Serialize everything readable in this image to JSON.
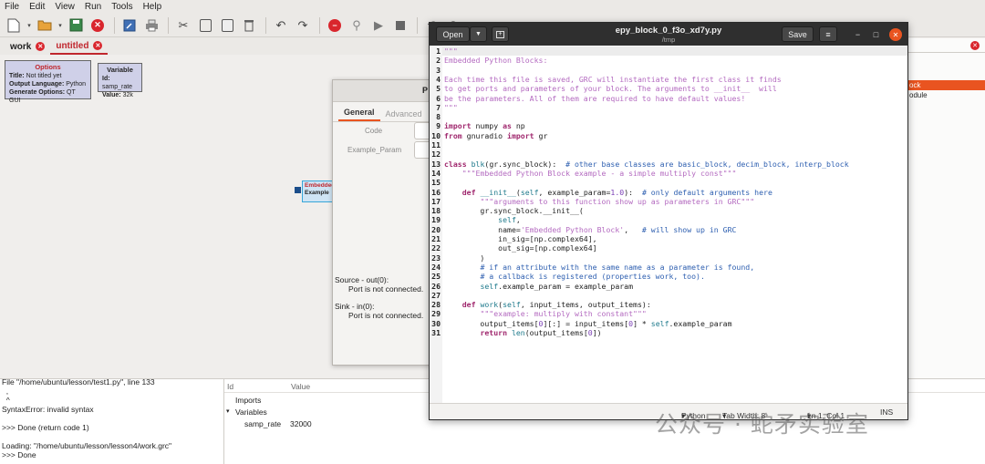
{
  "menubar": {
    "items": [
      "File",
      "Edit",
      "View",
      "Run",
      "Tools",
      "Help"
    ]
  },
  "tabs": [
    {
      "label": "work"
    },
    {
      "label": "untitled"
    }
  ],
  "options_block": {
    "title": "Options",
    "rows": [
      {
        "key": "Title:",
        "value": "Not titled yet"
      },
      {
        "key": "Output Language:",
        "value": "Python"
      },
      {
        "key": "Generate Options:",
        "value": "QT GUI"
      }
    ]
  },
  "variable_block": {
    "title": "Variable",
    "rows": [
      {
        "key": "Id:",
        "value": "samp_rate"
      },
      {
        "key": "Value:",
        "value": "32k"
      }
    ]
  },
  "python_block": {
    "title": "Embedded",
    "param": "Example"
  },
  "block_tree": {
    "selected": "ock",
    "item": "odule"
  },
  "properties_dialog": {
    "title": "P",
    "tabs": [
      "General",
      "Advanced"
    ],
    "fields": [
      {
        "label": "Code"
      },
      {
        "label": "Example_Param"
      }
    ],
    "ports": [
      {
        "title": "Source - out(0):",
        "message": "Port is not connected."
      },
      {
        "title": "Sink - in(0):",
        "message": "Port is not connected."
      }
    ]
  },
  "console": {
    "lines": [
      "File \"/home/ubuntu/lesson/test1.py\", line 133",
      "  ,",
      "  ^",
      "SyntaxError: invalid syntax",
      "",
      ">>> Done (return code 1)",
      "",
      "Loading: \"/home/ubuntu/lesson/lesson4/work.grc\"",
      ">>> Done"
    ]
  },
  "variables_panel": {
    "col_id": "Id",
    "col_value": "Value",
    "imports": "Imports",
    "variables": "Variables",
    "var_name": "samp_rate",
    "var_value": "32000"
  },
  "gedit": {
    "open_label": "Open",
    "save_label": "Save",
    "filename": "epy_block_0_f3o_xd7y.py",
    "path": "/tmp",
    "status": {
      "language": "Python",
      "tab_width": "Tab Width: 8",
      "position": "Ln 1, Col 1",
      "mode": "INS"
    }
  },
  "watermark": "公众号 · 蛇矛实验室"
}
